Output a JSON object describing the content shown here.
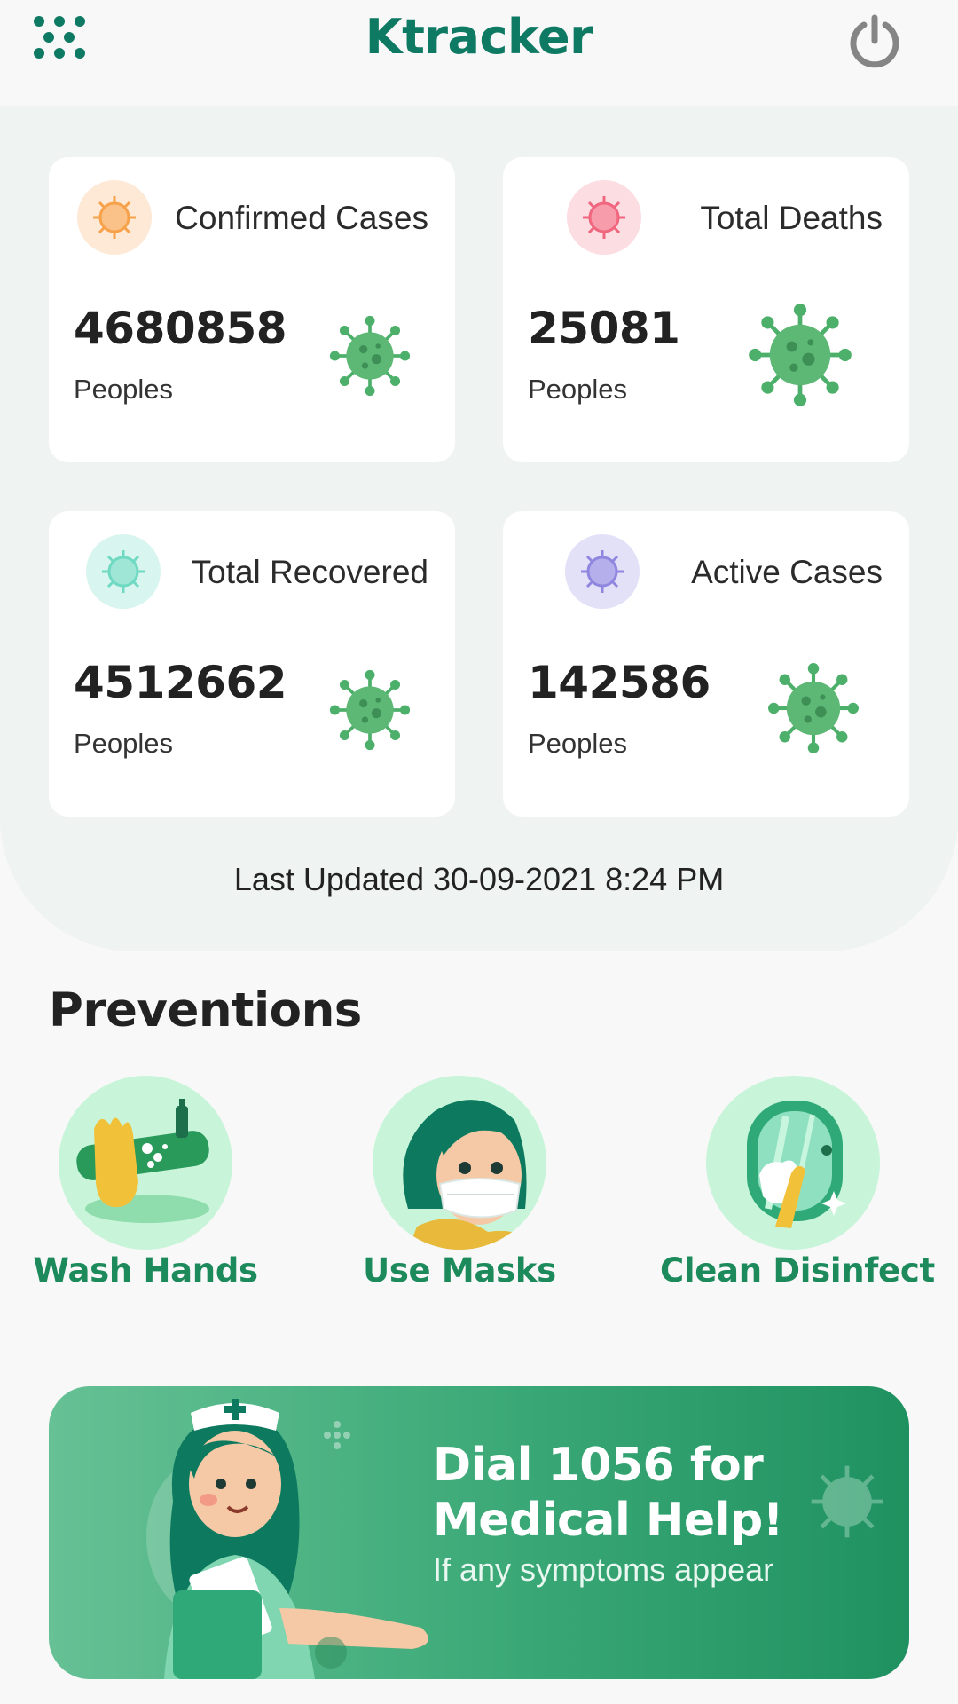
{
  "app": {
    "title": "Ktracker"
  },
  "stats": [
    {
      "label": "Confirmed Cases",
      "value": "4680858",
      "unit": "Peoples",
      "accent": "#f7a24b",
      "badge_bg": "#fde9d6"
    },
    {
      "label": "Total Deaths",
      "value": "25081",
      "unit": "Peoples",
      "accent": "#f0667e",
      "badge_bg": "#fcdde2"
    },
    {
      "label": "Total Recovered",
      "value": "4512662",
      "unit": "Peoples",
      "accent": "#6fd9c2",
      "badge_bg": "#d9f5ef"
    },
    {
      "label": "Active Cases",
      "value": "142586",
      "unit": "Peoples",
      "accent": "#8f86e0",
      "badge_bg": "#e3e1f8"
    }
  ],
  "last_updated": "Last Updated 30-09-2021 8:24 PM",
  "preventions": {
    "title": "Preventions",
    "items": [
      {
        "label": "Wash Hands",
        "icon": "wash-hands-icon"
      },
      {
        "label": "Use Masks",
        "icon": "mask-icon"
      },
      {
        "label": "Clean Disinfect",
        "icon": "disinfect-icon"
      }
    ]
  },
  "banner": {
    "title": "Dial 1056 for Medical Help!",
    "subtitle": "If any symptoms appear"
  },
  "colors": {
    "brand": "#0e7a63",
    "prevention_label": "#1c8a5b",
    "virus_green": "#4caf6a",
    "banner_start": "#66c195",
    "banner_end": "#1f9160"
  }
}
